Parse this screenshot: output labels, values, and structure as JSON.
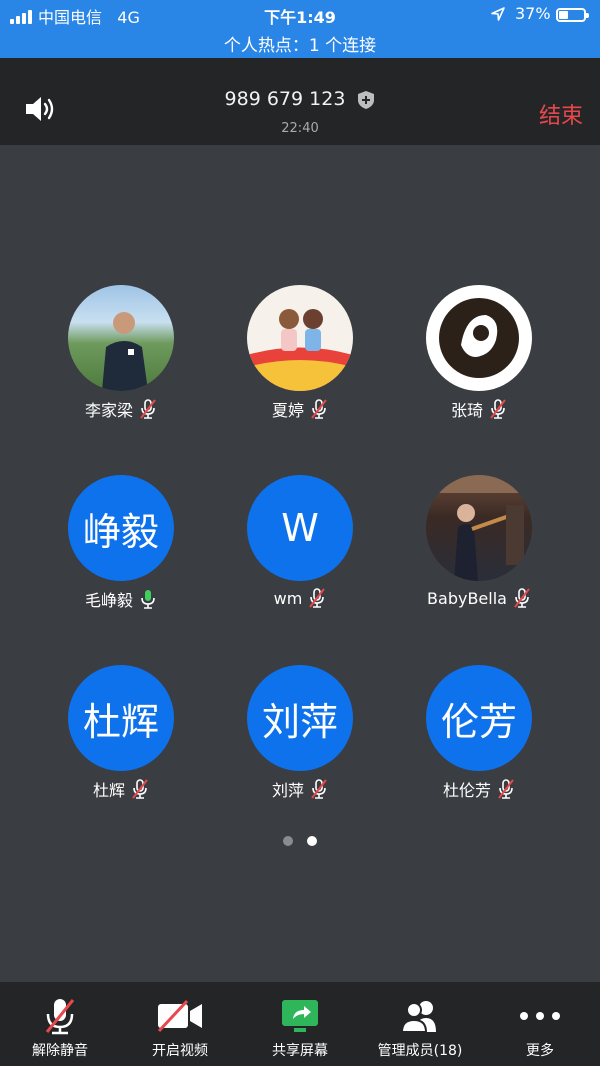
{
  "status_bar": {
    "carrier": "中国电信",
    "network": "4G",
    "time": "下午1:49",
    "battery": "37%",
    "battery_level": 0.37,
    "hotspot": "个人热点：1 个连接"
  },
  "header": {
    "meeting_id": "989 679 123",
    "duration": "22:40",
    "end_label": "结束"
  },
  "participants": [
    {
      "name": "李家梁",
      "avatar_type": "photo",
      "muted": true
    },
    {
      "name": "夏婷",
      "avatar_type": "photo",
      "muted": true
    },
    {
      "name": "张琦",
      "avatar_type": "photo",
      "muted": true
    },
    {
      "name": "毛峥毅",
      "avatar_text": "峥毅",
      "avatar_type": "initials",
      "muted": false
    },
    {
      "name": "wm",
      "avatar_text": "W",
      "avatar_type": "initials",
      "muted": true
    },
    {
      "name": "BabyBella",
      "avatar_type": "photo",
      "muted": true
    },
    {
      "name": "杜辉",
      "avatar_text": "杜辉",
      "avatar_type": "initials",
      "muted": true
    },
    {
      "name": "刘萍",
      "avatar_text": "刘萍",
      "avatar_type": "initials",
      "muted": true
    },
    {
      "name": "杜伦芳",
      "avatar_text": "伦芳",
      "avatar_type": "initials",
      "muted": true
    }
  ],
  "pagination": {
    "pages": 2,
    "current": 2
  },
  "toolbar": {
    "unmute": "解除静音",
    "start_video": "开启视频",
    "share_screen": "共享屏幕",
    "participants": "管理成员(18)",
    "more": "更多"
  },
  "colors": {
    "status_bar": "#2a86e6",
    "background": "#3a3d41",
    "bar": "#232527",
    "avatar_blue": "#0e72ed",
    "end_red": "#e8484b",
    "mic_green": "#3fd15c",
    "mute_red": "#e8484b"
  }
}
